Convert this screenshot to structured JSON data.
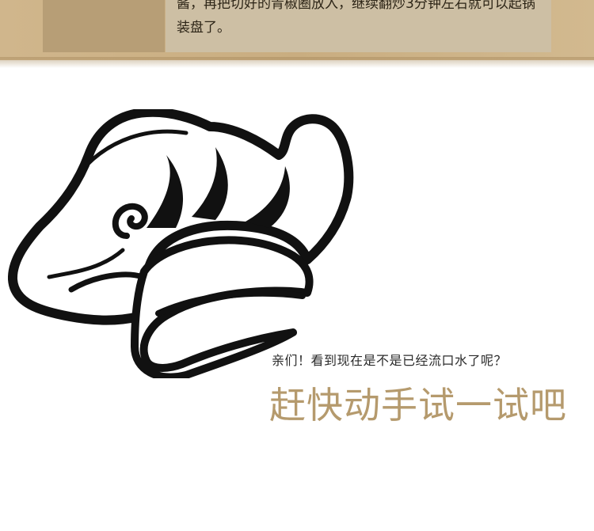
{
  "step": {
    "text": "酱，再把切好的青椒圈放入，继续翻炒3分钟左右就可以起锅装盘了。"
  },
  "promo": {
    "subtitle": "亲们！看到现在是不是已经流口水了呢？",
    "headline": "赶快动手试一试吧",
    "headline_color": "#b59a6d"
  },
  "icons": {
    "chef_hat": "chef-hat-icon"
  }
}
